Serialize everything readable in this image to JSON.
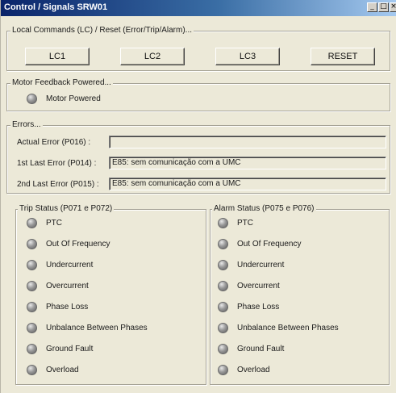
{
  "window": {
    "title": "Control / Signals SRW01",
    "controls": [
      "_",
      "□",
      "×"
    ]
  },
  "local_commands": {
    "legend": "Local Commands (LC) / Reset (Error/Trip/Alarm)...",
    "buttons": [
      "LC1",
      "LC2",
      "LC3",
      "RESET"
    ]
  },
  "motor_feedback": {
    "legend": "Motor Feedback Powered...",
    "item": "Motor Powered"
  },
  "errors": {
    "legend": "Errors...",
    "actual_label": "Actual Error (P016) :",
    "actual_value": "",
    "last1_label": "1st Last Error (P014) :",
    "last1_value": "E85: sem comunicação com a UMC",
    "last2_label": "2nd Last Error (P015) :",
    "last2_value": "E85: sem comunicação com a UMC"
  },
  "trip_status": {
    "legend": "Trip Status (P071 e P072)",
    "items": [
      "PTC",
      "Out Of Frequency",
      "Undercurrent",
      "Overcurrent",
      "Phase Loss",
      "Unbalance Between Phases",
      "Ground Fault",
      "Overload"
    ]
  },
  "alarm_status": {
    "legend": "Alarm Status (P075 e P076)",
    "items": [
      "PTC",
      "Out Of Frequency",
      "Undercurrent",
      "Overcurrent",
      "Phase Loss",
      "Unbalance Between Phases",
      "Ground Fault",
      "Overload"
    ]
  }
}
